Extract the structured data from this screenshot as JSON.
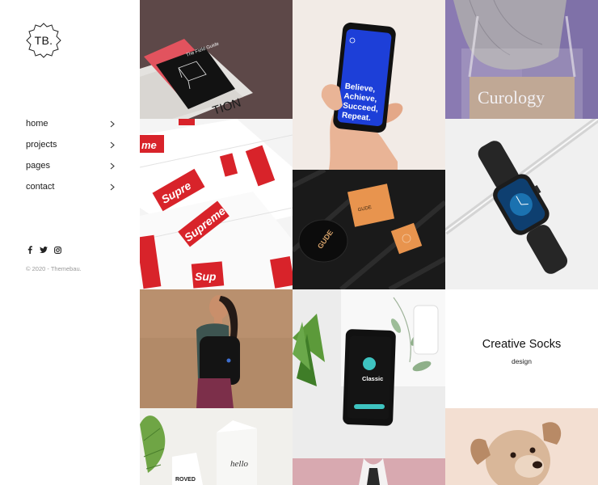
{
  "brand": {
    "logo_text": "TB."
  },
  "nav": {
    "items": [
      {
        "label": "home"
      },
      {
        "label": "projects"
      },
      {
        "label": "pages"
      },
      {
        "label": "contact"
      }
    ]
  },
  "social": {
    "icons": [
      "facebook-icon",
      "twitter-icon",
      "instagram-icon"
    ]
  },
  "footer": {
    "copyright": "© 2020 - Themebau."
  },
  "gallery": {
    "book_cover_text": "The Field Guide",
    "book_spine_text": "TION",
    "phone_text": "Believe, Achieve, Succeed, Repeat.",
    "bag_text": "Curology",
    "supreme_text": "Supreme",
    "gude_text": "GUDE",
    "app_text": "Classic",
    "carton_text": "hello",
    "carton_brand": "ROVED",
    "socks_card": {
      "title": "Creative Socks",
      "category": "design"
    }
  },
  "colors": {
    "text": "#1b1b1b",
    "muted": "#9a9a9a",
    "supreme_red": "#d8232a",
    "phone_blue": "#1d3fd8"
  }
}
